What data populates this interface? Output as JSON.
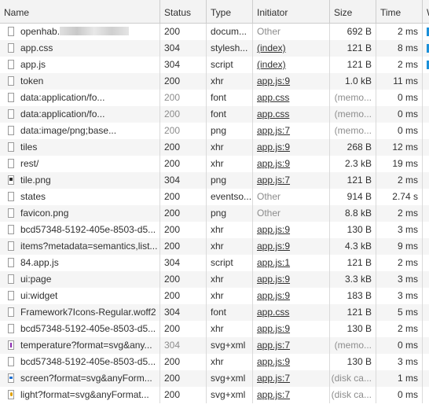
{
  "columns": {
    "name": "Name",
    "status": "Status",
    "type": "Type",
    "initiator": "Initiator",
    "size": "Size",
    "time": "Time",
    "waterfall": "W"
  },
  "rows": [
    {
      "name": "openhab.",
      "status": "200",
      "type": "docum...",
      "initiator": "Other",
      "size": "692 B",
      "time": "2 ms",
      "icon": "document-icon"
    },
    {
      "name": "app.css",
      "status": "304",
      "type": "stylesh...",
      "initiator": "(index)",
      "size": "121 B",
      "time": "8 ms",
      "icon": "file-icon"
    },
    {
      "name": "app.js",
      "status": "304",
      "type": "script",
      "initiator": "(index)",
      "size": "121 B",
      "time": "2 ms",
      "icon": "file-icon"
    },
    {
      "name": "token",
      "status": "200",
      "type": "xhr",
      "initiator": "app.js:9",
      "size": "1.0 kB",
      "time": "11 ms",
      "icon": "file-icon"
    },
    {
      "name": "data:application/fo...",
      "status": "200",
      "type": "font",
      "initiator": "app.css",
      "size": "(memo...",
      "time": "0 ms",
      "icon": "file-icon"
    },
    {
      "name": "data:application/fo...",
      "status": "200",
      "type": "font",
      "initiator": "app.css",
      "size": "(memo...",
      "time": "0 ms",
      "icon": "file-icon"
    },
    {
      "name": "data:image/png;base...",
      "status": "200",
      "type": "png",
      "initiator": "app.js:7",
      "size": "(memo...",
      "time": "0 ms",
      "icon": "file-icon"
    },
    {
      "name": "tiles",
      "status": "200",
      "type": "xhr",
      "initiator": "app.js:9",
      "size": "268 B",
      "time": "12 ms",
      "icon": "file-icon"
    },
    {
      "name": "rest/",
      "status": "200",
      "type": "xhr",
      "initiator": "app.js:9",
      "size": "2.3 kB",
      "time": "19 ms",
      "icon": "file-icon"
    },
    {
      "name": "tile.png",
      "status": "304",
      "type": "png",
      "initiator": "app.js:7",
      "size": "121 B",
      "time": "2 ms",
      "icon": "image-icon"
    },
    {
      "name": "states",
      "status": "200",
      "type": "eventso...",
      "initiator": "Other",
      "size": "914 B",
      "time": "2.74 s",
      "icon": "file-icon"
    },
    {
      "name": "favicon.png",
      "status": "200",
      "type": "png",
      "initiator": "Other",
      "size": "8.8 kB",
      "time": "2 ms",
      "icon": "file-icon"
    },
    {
      "name": "bcd57348-5192-405e-8503-d5...",
      "status": "200",
      "type": "xhr",
      "initiator": "app.js:9",
      "size": "130 B",
      "time": "3 ms",
      "icon": "file-icon"
    },
    {
      "name": "items?metadata=semantics,list...",
      "status": "200",
      "type": "xhr",
      "initiator": "app.js:9",
      "size": "4.3 kB",
      "time": "9 ms",
      "icon": "file-icon"
    },
    {
      "name": "84.app.js",
      "status": "304",
      "type": "script",
      "initiator": "app.js:1",
      "size": "121 B",
      "time": "2 ms",
      "icon": "file-icon"
    },
    {
      "name": "ui:page",
      "status": "200",
      "type": "xhr",
      "initiator": "app.js:9",
      "size": "3.3 kB",
      "time": "3 ms",
      "icon": "file-icon"
    },
    {
      "name": "ui:widget",
      "status": "200",
      "type": "xhr",
      "initiator": "app.js:9",
      "size": "183 B",
      "time": "3 ms",
      "icon": "file-icon"
    },
    {
      "name": "Framework7Icons-Regular.woff2",
      "status": "304",
      "type": "font",
      "initiator": "app.css",
      "size": "121 B",
      "time": "5 ms",
      "icon": "file-icon"
    },
    {
      "name": "bcd57348-5192-405e-8503-d5...",
      "status": "200",
      "type": "xhr",
      "initiator": "app.js:9",
      "size": "130 B",
      "time": "2 ms",
      "icon": "file-icon"
    },
    {
      "name": "temperature?format=svg&any...",
      "status": "304",
      "type": "svg+xml",
      "initiator": "app.js:7",
      "size": "(memo...",
      "time": "0 ms",
      "icon": "svg-thermometer-icon"
    },
    {
      "name": "bcd57348-5192-405e-8503-d5...",
      "status": "200",
      "type": "xhr",
      "initiator": "app.js:9",
      "size": "130 B",
      "time": "3 ms",
      "icon": "file-icon"
    },
    {
      "name": "screen?format=svg&anyForm...",
      "status": "200",
      "type": "svg+xml",
      "initiator": "app.js:7",
      "size": "(disk ca...",
      "time": "1 ms",
      "icon": "svg-screen-icon"
    },
    {
      "name": "light?format=svg&anyFormat...",
      "status": "200",
      "type": "svg+xml",
      "initiator": "app.js:7",
      "size": "(disk ca...",
      "time": "0 ms",
      "icon": "svg-light-icon"
    }
  ],
  "colors": {
    "header_bg": "#f3f3f3",
    "alt_row_bg": "#f5f5f5",
    "waterfall_bar": "#1a8fd8",
    "dim_text": "#8c8c8c"
  }
}
